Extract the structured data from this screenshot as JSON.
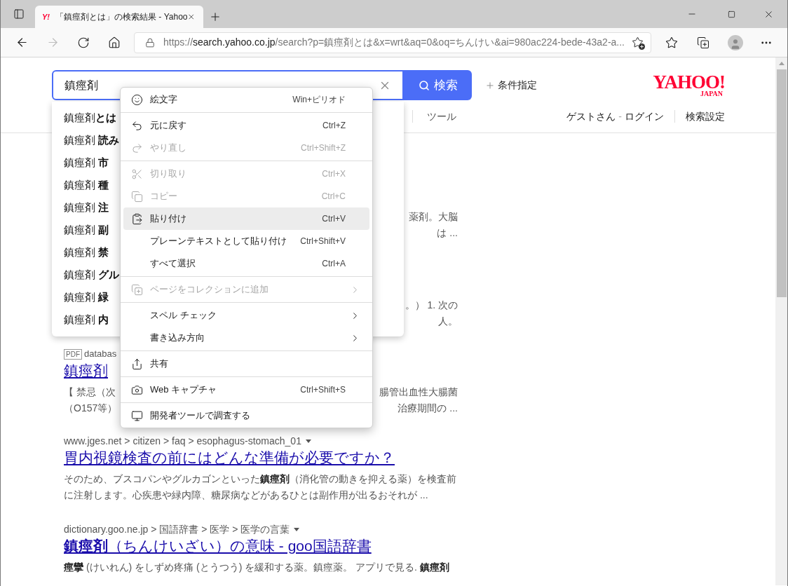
{
  "browser": {
    "tabs": [
      {
        "favicon": "Y!",
        "title": "「鎮痙剤とは」の検索結果 - Yahoo",
        "selected": true
      }
    ],
    "forward_disabled": true,
    "address_bar": {
      "scheme": "https://",
      "host": "search.yahoo.co.jp",
      "path": "/search?p=鎮痙剤とは&x=wrt&aq=0&oq=ちんけい&ai=980ac224-bede-43a2-a..."
    }
  },
  "search": {
    "value": "鎮痙剤",
    "button": "検索",
    "advanced": "条件指定"
  },
  "logo": {
    "text": "YAHOO!",
    "subtext": "JAPAN"
  },
  "nav": {
    "tools": "ツール",
    "guest": "ゲストさん",
    "separator": "-",
    "login": "ログイン",
    "settings": "検索設定"
  },
  "suggestions": [
    "鎮痙剤**とは**",
    "鎮痙剤 **読み**",
    "鎮痙剤 **市**",
    "鎮痙剤 **種**",
    "鎮痙剤 **注**",
    "鎮痙剤 **副**",
    "鎮痙剤 **禁**",
    "鎮痙剤 **グル**",
    "鎮痙剤 **緑**",
    "鎮痙剤 **内**"
  ],
  "results": [
    {
      "snippet_lines": [
        {
          "right": "薬剤。大脳"
        },
        {
          "right": "は ..."
        }
      ]
    },
    {
      "snippet_lines": [
        {
          "right": "。） 1. 次の"
        },
        {
          "right": "人。"
        }
      ]
    },
    {
      "badge": "PDF",
      "url": "databas",
      "title": "鎮痙剤",
      "snippet_lines": [
        {
          "left": "【 禁忌（次",
          "right": "腸管出血性大腸菌"
        },
        {
          "left": "（O157等）",
          "right": "治療期間の ..."
        }
      ]
    },
    {
      "url": "www.jges.net > citizen > faq > esophagus-stomach_01",
      "title": "胃内視鏡検査の前にはどんな準備が必要ですか？",
      "snippet": [
        "そのため、ブスコパンやグルカゴンといった**鎮痙剤**（消化管の動きを抑える薬）を検査前",
        "に注射します。心疾患や緑内障、糖尿病などがあるひとは副作用が出るおそれが ..."
      ]
    },
    {
      "url": "dictionary.goo.ne.jp > 国語辞書 > 医学 > 医学の言葉",
      "title": "**鎮痙剤**（ちんけいざい）の意味 - goo国語辞書",
      "snippet": [
        "**痙攣** (けいれん) をしずめ疼痛 (とうつう) を緩和する薬。鎮痙薬。 アプリで見る. **鎮痙剤**"
      ]
    }
  ],
  "context_menu": [
    {
      "kind": "item",
      "label": "絵文字",
      "shortcut": "Win+ピリオド",
      "disabled": false,
      "highlighted": false,
      "submenu": false
    },
    {
      "kind": "separator"
    },
    {
      "kind": "item",
      "label": "元に戻す",
      "shortcut": "Ctrl+Z",
      "disabled": false,
      "highlighted": false,
      "submenu": false
    },
    {
      "kind": "item",
      "label": "やり直し",
      "shortcut": "Ctrl+Shift+Z",
      "disabled": true,
      "highlighted": false,
      "submenu": false
    },
    {
      "kind": "separator"
    },
    {
      "kind": "item",
      "label": "切り取り",
      "shortcut": "Ctrl+X",
      "disabled": true,
      "highlighted": false,
      "submenu": false
    },
    {
      "kind": "item",
      "label": "コピー",
      "shortcut": "Ctrl+C",
      "disabled": true,
      "highlighted": false,
      "submenu": false
    },
    {
      "kind": "item",
      "label": "貼り付け",
      "shortcut": "Ctrl+V",
      "disabled": false,
      "highlighted": true,
      "submenu": false
    },
    {
      "kind": "item",
      "label": "プレーンテキストとして貼り付け",
      "shortcut": "Ctrl+Shift+V",
      "disabled": false,
      "highlighted": false,
      "submenu": false
    },
    {
      "kind": "item",
      "label": "すべて選択",
      "shortcut": "Ctrl+A",
      "disabled": false,
      "highlighted": false,
      "submenu": false
    },
    {
      "kind": "separator"
    },
    {
      "kind": "item",
      "label": "ページをコレクションに追加",
      "disabled": true,
      "highlighted": false,
      "submenu": true
    },
    {
      "kind": "separator"
    },
    {
      "kind": "item",
      "label": "スペル チェック",
      "disabled": false,
      "highlighted": false,
      "submenu": true
    },
    {
      "kind": "item",
      "label": "書き込み方向",
      "disabled": false,
      "highlighted": false,
      "submenu": true
    },
    {
      "kind": "separator"
    },
    {
      "kind": "item",
      "label": "共有",
      "disabled": false,
      "highlighted": false,
      "submenu": false
    },
    {
      "kind": "separator"
    },
    {
      "kind": "item",
      "label": "Web キャプチャ",
      "shortcut": "Ctrl+Shift+S",
      "disabled": false,
      "highlighted": false,
      "submenu": false
    },
    {
      "kind": "separator"
    },
    {
      "kind": "item",
      "label": "開発者ツールで調査する",
      "disabled": false,
      "highlighted": false,
      "submenu": false
    }
  ]
}
